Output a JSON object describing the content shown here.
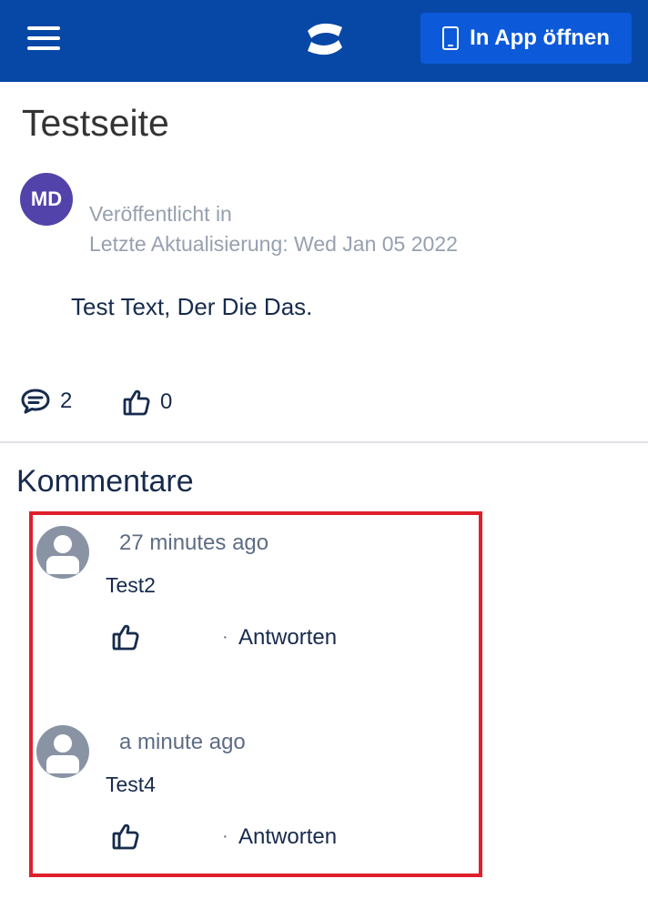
{
  "header": {
    "open_app_label": "In App öffnen"
  },
  "page": {
    "title": "Testseite",
    "author_initials": "MD",
    "published_in": "Veröffentlicht in",
    "last_updated": "Letzte Aktualisierung: Wed Jan 05 2022",
    "body": "Test Text, Der Die Das.",
    "comment_count": "2",
    "like_count": "0"
  },
  "comments_section": {
    "title": "Kommentare",
    "comments": [
      {
        "time": "27 minutes ago",
        "text": "Test2",
        "reply_label": "Antworten"
      },
      {
        "time": "a minute ago",
        "text": "Test4",
        "reply_label": "Antworten"
      }
    ]
  },
  "colors": {
    "header_bg": "#0747a6",
    "button_bg": "#0c5ad9",
    "avatar_bg": "#5243aa",
    "highlight_border": "#e01f2c"
  }
}
